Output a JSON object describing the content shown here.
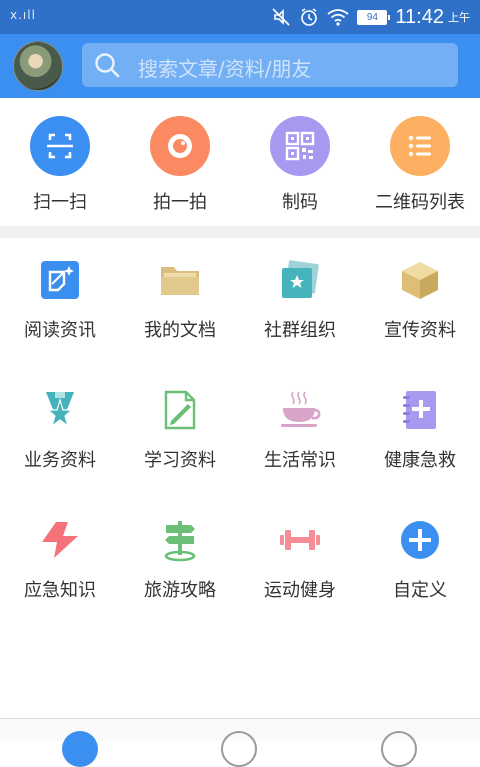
{
  "status": {
    "signal": "x.ıll",
    "battery": "94",
    "time": "11:42",
    "ampm": "上午"
  },
  "search": {
    "placeholder": "搜索文章/资料/朋友"
  },
  "quick": [
    {
      "label": "扫一扫",
      "icon": "scan-icon",
      "color": "#3a8ff0"
    },
    {
      "label": "拍一拍",
      "icon": "camera-shutter-icon",
      "color": "#fb8a62"
    },
    {
      "label": "制码",
      "icon": "qr-code-icon",
      "color": "#a59af0"
    },
    {
      "label": "二维码列表",
      "icon": "list-icon",
      "color": "#fdb061"
    }
  ],
  "grid": [
    {
      "label": "阅读资讯",
      "icon": "reading-icon"
    },
    {
      "label": "我的文档",
      "icon": "folder-icon"
    },
    {
      "label": "社群组织",
      "icon": "community-icon"
    },
    {
      "label": "宣传资料",
      "icon": "box-icon"
    },
    {
      "label": "业务资料",
      "icon": "award-icon"
    },
    {
      "label": "学习资料",
      "icon": "edit-document-icon"
    },
    {
      "label": "生活常识",
      "icon": "coffee-cup-icon"
    },
    {
      "label": "健康急救",
      "icon": "first-aid-book-icon"
    },
    {
      "label": "应急知识",
      "icon": "lightning-icon"
    },
    {
      "label": "旅游攻略",
      "icon": "signpost-icon"
    },
    {
      "label": "运动健身",
      "icon": "dumbbell-icon"
    },
    {
      "label": "自定义",
      "icon": "add-circle-icon"
    }
  ]
}
